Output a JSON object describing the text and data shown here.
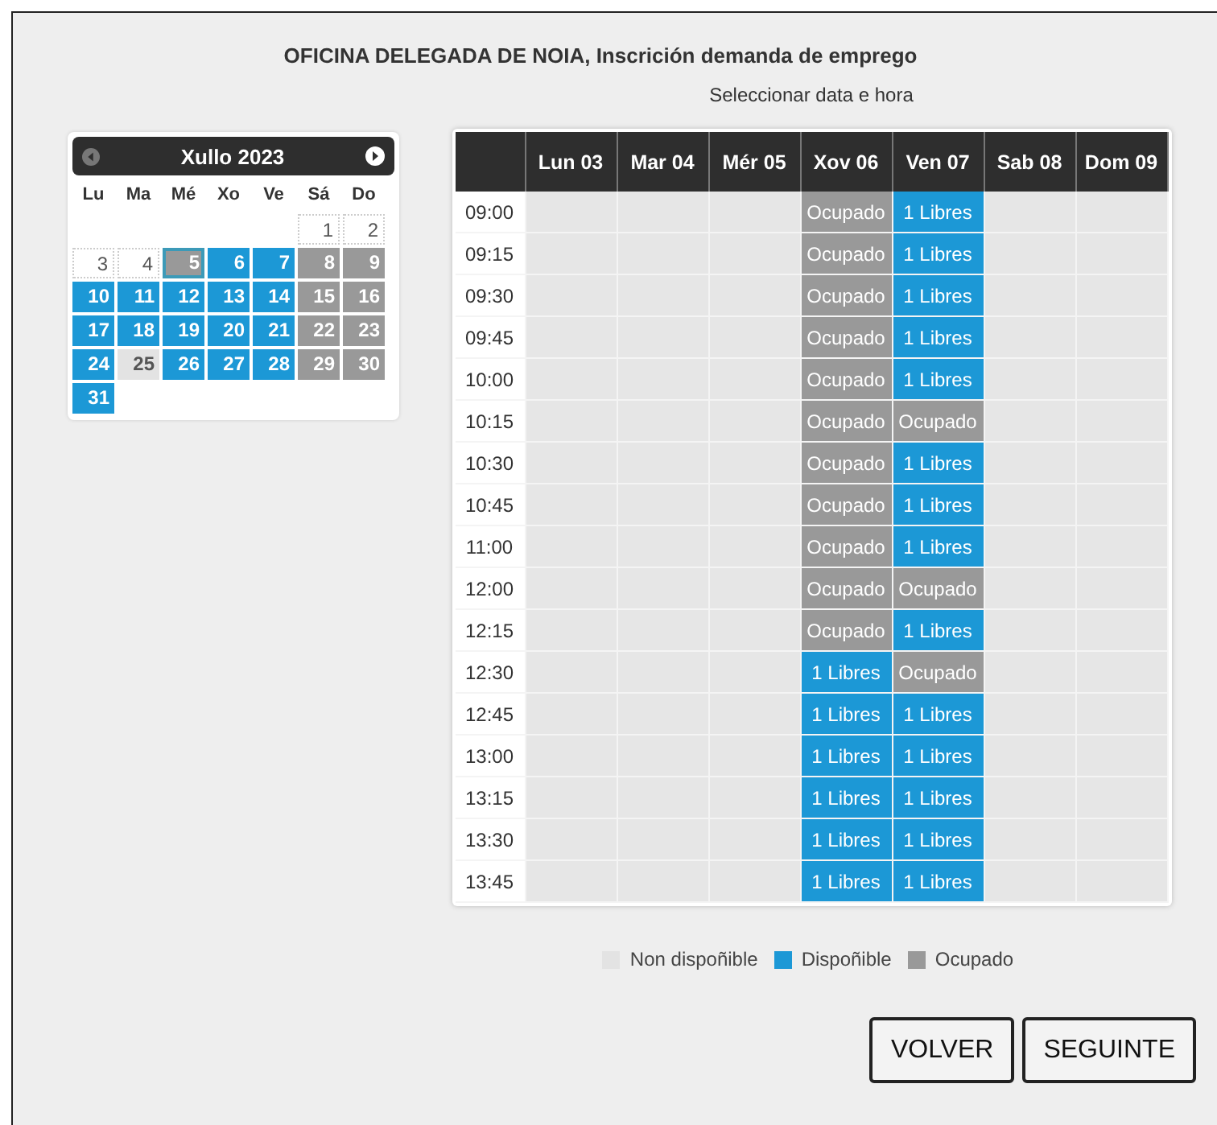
{
  "title": "OFICINA DELEGADA DE NOIA, Inscrición demanda de emprego",
  "subtitle": "Seleccionar data e hora",
  "calendar": {
    "month": "Xullo 2023",
    "weekdays": [
      "Lu",
      "Ma",
      "Mé",
      "Xo",
      "Ve",
      "Sá",
      "Do"
    ],
    "weeks": [
      [
        {
          "kind": "blank"
        },
        {
          "kind": "blank"
        },
        {
          "kind": "blank"
        },
        {
          "kind": "blank"
        },
        {
          "kind": "blank"
        },
        {
          "kind": "free",
          "day": "1",
          "selected": false
        },
        {
          "kind": "free",
          "day": "2",
          "selected": false
        }
      ],
      [
        {
          "kind": "free",
          "day": "3",
          "selected": false
        },
        {
          "kind": "free",
          "day": "4",
          "selected": false
        },
        {
          "kind": "busy",
          "day": "5",
          "selected": true
        },
        {
          "kind": "open",
          "day": "6",
          "selected": false
        },
        {
          "kind": "open",
          "day": "7",
          "selected": false
        },
        {
          "kind": "busy",
          "day": "8",
          "selected": false
        },
        {
          "kind": "busy",
          "day": "9",
          "selected": false
        }
      ],
      [
        {
          "kind": "open",
          "day": "10",
          "selected": false
        },
        {
          "kind": "open",
          "day": "11",
          "selected": false
        },
        {
          "kind": "open",
          "day": "12",
          "selected": false
        },
        {
          "kind": "open",
          "day": "13",
          "selected": false
        },
        {
          "kind": "open",
          "day": "14",
          "selected": false
        },
        {
          "kind": "busy",
          "day": "15",
          "selected": false
        },
        {
          "kind": "busy",
          "day": "16",
          "selected": false
        }
      ],
      [
        {
          "kind": "open",
          "day": "17",
          "selected": false
        },
        {
          "kind": "open",
          "day": "18",
          "selected": false
        },
        {
          "kind": "open",
          "day": "19",
          "selected": false
        },
        {
          "kind": "open",
          "day": "20",
          "selected": false
        },
        {
          "kind": "open",
          "day": "21",
          "selected": false
        },
        {
          "kind": "busy",
          "day": "22",
          "selected": false
        },
        {
          "kind": "busy",
          "day": "23",
          "selected": false
        }
      ],
      [
        {
          "kind": "open",
          "day": "24",
          "selected": false
        },
        {
          "kind": "off",
          "day": "25",
          "selected": false
        },
        {
          "kind": "open",
          "day": "26",
          "selected": false
        },
        {
          "kind": "open",
          "day": "27",
          "selected": false
        },
        {
          "kind": "open",
          "day": "28",
          "selected": false
        },
        {
          "kind": "busy",
          "day": "29",
          "selected": false
        },
        {
          "kind": "busy",
          "day": "30",
          "selected": false
        }
      ],
      [
        {
          "kind": "open",
          "day": "31",
          "selected": false
        }
      ]
    ]
  },
  "schedule": {
    "columns": [
      "Lun 03",
      "Mar 04",
      "Mér 05",
      "Xov 06",
      "Ven 07",
      "Sab 08",
      "Dom 09"
    ],
    "rows": [
      {
        "time": "09:00",
        "cells": [
          {
            "kind": "off"
          },
          {
            "kind": "off"
          },
          {
            "kind": "off"
          },
          {
            "kind": "busy",
            "text": "Ocupado"
          },
          {
            "kind": "open",
            "text": "1 Libres"
          },
          {
            "kind": "off"
          },
          {
            "kind": "off"
          }
        ]
      },
      {
        "time": "09:15",
        "cells": [
          {
            "kind": "off"
          },
          {
            "kind": "off"
          },
          {
            "kind": "off"
          },
          {
            "kind": "busy",
            "text": "Ocupado"
          },
          {
            "kind": "open",
            "text": "1 Libres"
          },
          {
            "kind": "off"
          },
          {
            "kind": "off"
          }
        ]
      },
      {
        "time": "09:30",
        "cells": [
          {
            "kind": "off"
          },
          {
            "kind": "off"
          },
          {
            "kind": "off"
          },
          {
            "kind": "busy",
            "text": "Ocupado"
          },
          {
            "kind": "open",
            "text": "1 Libres"
          },
          {
            "kind": "off"
          },
          {
            "kind": "off"
          }
        ]
      },
      {
        "time": "09:45",
        "cells": [
          {
            "kind": "off"
          },
          {
            "kind": "off"
          },
          {
            "kind": "off"
          },
          {
            "kind": "busy",
            "text": "Ocupado"
          },
          {
            "kind": "open",
            "text": "1 Libres"
          },
          {
            "kind": "off"
          },
          {
            "kind": "off"
          }
        ]
      },
      {
        "time": "10:00",
        "cells": [
          {
            "kind": "off"
          },
          {
            "kind": "off"
          },
          {
            "kind": "off"
          },
          {
            "kind": "busy",
            "text": "Ocupado"
          },
          {
            "kind": "open",
            "text": "1 Libres"
          },
          {
            "kind": "off"
          },
          {
            "kind": "off"
          }
        ]
      },
      {
        "time": "10:15",
        "cells": [
          {
            "kind": "off"
          },
          {
            "kind": "off"
          },
          {
            "kind": "off"
          },
          {
            "kind": "busy",
            "text": "Ocupado"
          },
          {
            "kind": "busy",
            "text": "Ocupado"
          },
          {
            "kind": "off"
          },
          {
            "kind": "off"
          }
        ]
      },
      {
        "time": "10:30",
        "cells": [
          {
            "kind": "off"
          },
          {
            "kind": "off"
          },
          {
            "kind": "off"
          },
          {
            "kind": "busy",
            "text": "Ocupado"
          },
          {
            "kind": "open",
            "text": "1 Libres"
          },
          {
            "kind": "off"
          },
          {
            "kind": "off"
          }
        ]
      },
      {
        "time": "10:45",
        "cells": [
          {
            "kind": "off"
          },
          {
            "kind": "off"
          },
          {
            "kind": "off"
          },
          {
            "kind": "busy",
            "text": "Ocupado"
          },
          {
            "kind": "open",
            "text": "1 Libres"
          },
          {
            "kind": "off"
          },
          {
            "kind": "off"
          }
        ]
      },
      {
        "time": "11:00",
        "cells": [
          {
            "kind": "off"
          },
          {
            "kind": "off"
          },
          {
            "kind": "off"
          },
          {
            "kind": "busy",
            "text": "Ocupado"
          },
          {
            "kind": "open",
            "text": "1 Libres"
          },
          {
            "kind": "off"
          },
          {
            "kind": "off"
          }
        ]
      },
      {
        "time": "12:00",
        "cells": [
          {
            "kind": "off"
          },
          {
            "kind": "off"
          },
          {
            "kind": "off"
          },
          {
            "kind": "busy",
            "text": "Ocupado"
          },
          {
            "kind": "busy",
            "text": "Ocupado"
          },
          {
            "kind": "off"
          },
          {
            "kind": "off"
          }
        ]
      },
      {
        "time": "12:15",
        "cells": [
          {
            "kind": "off"
          },
          {
            "kind": "off"
          },
          {
            "kind": "off"
          },
          {
            "kind": "busy",
            "text": "Ocupado"
          },
          {
            "kind": "open",
            "text": "1 Libres"
          },
          {
            "kind": "off"
          },
          {
            "kind": "off"
          }
        ]
      },
      {
        "time": "12:30",
        "cells": [
          {
            "kind": "off"
          },
          {
            "kind": "off"
          },
          {
            "kind": "off"
          },
          {
            "kind": "open",
            "text": "1 Libres"
          },
          {
            "kind": "busy",
            "text": "Ocupado"
          },
          {
            "kind": "off"
          },
          {
            "kind": "off"
          }
        ]
      },
      {
        "time": "12:45",
        "cells": [
          {
            "kind": "off"
          },
          {
            "kind": "off"
          },
          {
            "kind": "off"
          },
          {
            "kind": "open",
            "text": "1 Libres"
          },
          {
            "kind": "open",
            "text": "1 Libres"
          },
          {
            "kind": "off"
          },
          {
            "kind": "off"
          }
        ]
      },
      {
        "time": "13:00",
        "cells": [
          {
            "kind": "off"
          },
          {
            "kind": "off"
          },
          {
            "kind": "off"
          },
          {
            "kind": "open",
            "text": "1 Libres"
          },
          {
            "kind": "open",
            "text": "1 Libres"
          },
          {
            "kind": "off"
          },
          {
            "kind": "off"
          }
        ]
      },
      {
        "time": "13:15",
        "cells": [
          {
            "kind": "off"
          },
          {
            "kind": "off"
          },
          {
            "kind": "off"
          },
          {
            "kind": "open",
            "text": "1 Libres"
          },
          {
            "kind": "open",
            "text": "1 Libres"
          },
          {
            "kind": "off"
          },
          {
            "kind": "off"
          }
        ]
      },
      {
        "time": "13:30",
        "cells": [
          {
            "kind": "off"
          },
          {
            "kind": "off"
          },
          {
            "kind": "off"
          },
          {
            "kind": "open",
            "text": "1 Libres"
          },
          {
            "kind": "open",
            "text": "1 Libres"
          },
          {
            "kind": "off"
          },
          {
            "kind": "off"
          }
        ]
      },
      {
        "time": "13:45",
        "cells": [
          {
            "kind": "off"
          },
          {
            "kind": "off"
          },
          {
            "kind": "off"
          },
          {
            "kind": "open",
            "text": "1 Libres"
          },
          {
            "kind": "open",
            "text": "1 Libres"
          },
          {
            "kind": "off"
          },
          {
            "kind": "off"
          }
        ]
      }
    ]
  },
  "legend": [
    {
      "kind": "off",
      "label": "Non dispoñible"
    },
    {
      "kind": "open",
      "label": "Dispoñible"
    },
    {
      "kind": "busy",
      "label": "Ocupado"
    }
  ],
  "buttons": [
    "VOLVER",
    "SEGUINTE"
  ]
}
